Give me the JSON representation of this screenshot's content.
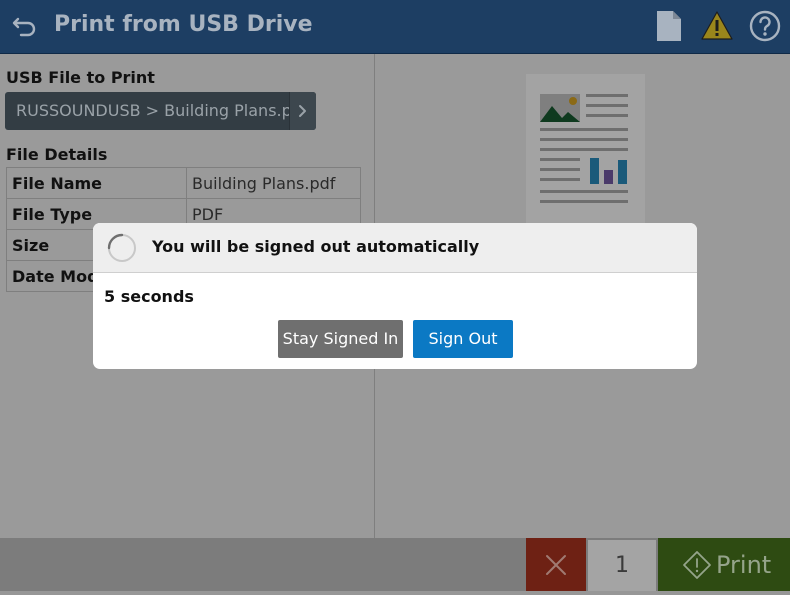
{
  "header": {
    "title": "Print from USB Drive"
  },
  "left": {
    "usb_label": "USB File to Print",
    "file_path": "RUSSOUNDUSB > Building Plans.pdf",
    "details_label": "File Details",
    "details": [
      {
        "key": "File Name",
        "value": "Building Plans.pdf"
      },
      {
        "key": "File Type",
        "value": "PDF"
      },
      {
        "key": "Size",
        "value": ""
      },
      {
        "key": "Date Modi",
        "value": ""
      }
    ]
  },
  "modal": {
    "title": "You will be signed out automatically",
    "countdown": "5 seconds",
    "stay_label": "Stay Signed In",
    "signout_label": "Sign Out"
  },
  "bottom": {
    "copies": "1",
    "print_label": "Print"
  },
  "colors": {
    "header": "#1d3e63",
    "signout_button": "#0b79c4",
    "print_button": "#2e4b12",
    "cancel_button": "#6e2114"
  },
  "icons": [
    "back-arrow-icon",
    "document-icon",
    "warning-icon",
    "help-icon",
    "chevron-right-icon",
    "spinner-icon",
    "close-icon",
    "start-diamond-icon"
  ]
}
